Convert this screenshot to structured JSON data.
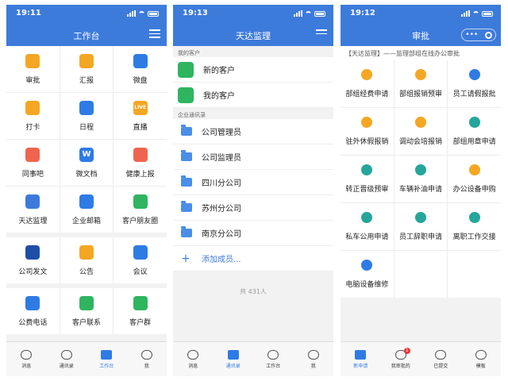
{
  "status_bar": {
    "p1_time": "19:11",
    "p2_time": "19:13",
    "p3_time": "19:12"
  },
  "panel1": {
    "title": "工作台",
    "apps": [
      {
        "label": "审批",
        "icon": "approval-icon",
        "color": "#f5a623"
      },
      {
        "label": "汇报",
        "icon": "report-icon",
        "color": "#f5a623"
      },
      {
        "label": "微盘",
        "icon": "drive-icon",
        "color": "#2e7be6"
      },
      {
        "label": "打卡",
        "icon": "location-icon",
        "color": "#f5a623"
      },
      {
        "label": "日程",
        "icon": "calendar-icon",
        "color": "#2e7be6"
      },
      {
        "label": "直播",
        "icon": "live-icon",
        "color": "#f5a623",
        "glyph": "LIVE"
      },
      {
        "label": "同事吧",
        "icon": "community-icon",
        "color": "#f0644f"
      },
      {
        "label": "微文档",
        "icon": "document-icon",
        "color": "#2e7be6",
        "glyph": "W"
      },
      {
        "label": "健康上报",
        "icon": "health-icon",
        "color": "#f0644f"
      },
      {
        "label": "天达监理",
        "icon": "tianda-logo-icon",
        "color": "#3d7bdb"
      },
      {
        "label": "企业邮箱",
        "icon": "mail-icon",
        "color": "#2e7be6"
      },
      {
        "label": "客户朋友圈",
        "icon": "moments-icon",
        "color": "#2fb55f"
      }
    ],
    "apps2": [
      {
        "label": "公司发文",
        "icon": "company-logo-icon",
        "color": "#1e4fa8"
      },
      {
        "label": "公告",
        "icon": "announcement-icon",
        "color": "#f5a623"
      },
      {
        "label": "会议",
        "icon": "meeting-icon",
        "color": "#2e7be6"
      }
    ],
    "apps3": [
      {
        "label": "公费电话",
        "icon": "phone-icon",
        "color": "#2e7be6"
      },
      {
        "label": "客户联系",
        "icon": "contact-icon",
        "color": "#2fb55f"
      },
      {
        "label": "客户群",
        "icon": "customer-group-icon",
        "color": "#2fb55f"
      }
    ],
    "tabs": [
      {
        "label": "消息",
        "active": false
      },
      {
        "label": "通讯录",
        "active": false
      },
      {
        "label": "工作台",
        "active": true
      },
      {
        "label": "我",
        "active": false
      }
    ]
  },
  "panel2": {
    "title": "天达监理",
    "section_customers": "我的客户",
    "customers": [
      {
        "label": "新的客户",
        "icon": "new-customer-icon",
        "color": "#2fb55f"
      },
      {
        "label": "我的客户",
        "icon": "wechat-icon",
        "color": "#2fb55f"
      }
    ],
    "section_directory": "企业通讯录",
    "departments": [
      "公司管理员",
      "公司监理员",
      "四川分公司",
      "苏州分公司",
      "南京分公司"
    ],
    "add_member": "添加成员...",
    "count": "共 431人",
    "tabs": [
      {
        "label": "消息",
        "active": false
      },
      {
        "label": "通讯录",
        "active": true
      },
      {
        "label": "工作台",
        "active": false
      },
      {
        "label": "我",
        "active": false
      }
    ]
  },
  "panel3": {
    "title": "审批",
    "banner": "【天达监理】——监理部组在线办公审批",
    "items": [
      {
        "label": "部组经费申请",
        "color": "#f5a623"
      },
      {
        "label": "部组报销预审",
        "color": "#f5a623"
      },
      {
        "label": "员工请假报批",
        "color": "#2e7be6"
      },
      {
        "label": "驻外休假报销",
        "color": "#f5a623"
      },
      {
        "label": "调动会培报销",
        "color": "#f5a623"
      },
      {
        "label": "部组用章申请",
        "color": "#26a69a"
      },
      {
        "label": "转正晋级预审",
        "color": "#26a69a"
      },
      {
        "label": "车辆补油申请",
        "color": "#26a69a"
      },
      {
        "label": "办公设备申购",
        "color": "#f5a623"
      },
      {
        "label": "私车公用申请",
        "color": "#26a69a"
      },
      {
        "label": "员工辞职申请",
        "color": "#26a69a"
      },
      {
        "label": "离职工作交接",
        "color": "#26a69a"
      },
      {
        "label": "电脑设备维修",
        "color": "#2e7be6"
      }
    ],
    "tabs": [
      {
        "label": "新申请",
        "active": true
      },
      {
        "label": "我审批的",
        "active": false,
        "badge": "1"
      },
      {
        "label": "已提交",
        "active": false
      },
      {
        "label": "模板",
        "active": false
      }
    ]
  }
}
